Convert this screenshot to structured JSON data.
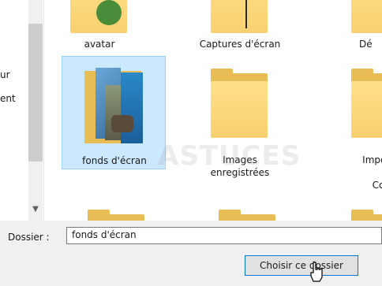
{
  "nav": {
    "items": [
      "ur",
      "ent"
    ]
  },
  "tiles": [
    {
      "label": "avatar"
    },
    {
      "label": "Captures d'écran"
    },
    {
      "label": "Dé"
    },
    {
      "label": "fonds d'écran"
    },
    {
      "label": "Images\nenregistrées"
    },
    {
      "label": "Import\nPh\nCom"
    }
  ],
  "bottom": {
    "dossier_label": "Dossier :",
    "dossier_value": "fonds d'écran",
    "choose_button": "Choisir ce dossier"
  },
  "watermark": "ASTUCES",
  "colors": {
    "selection": "#cce8ff",
    "folder": "#f8d070",
    "button_border": "#0078d7"
  }
}
